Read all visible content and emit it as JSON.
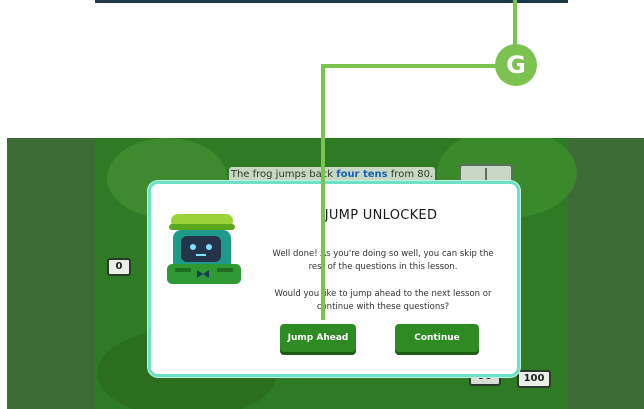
{
  "callout": {
    "label": "G"
  },
  "game": {
    "question_prefix": "The frog jumps back ",
    "question_emph": "four tens",
    "question_suffix": " from 80.",
    "numbers": {
      "start": "0",
      "near_end": "90",
      "end": "100"
    }
  },
  "modal": {
    "title": "JUMP UNLOCKED",
    "paragraph1": "Well done! As you're doing so well, you can skip the rest of the questions in this lesson.",
    "paragraph2": "Would you like to jump ahead to the next lesson or continue with these questions?",
    "jump_ahead_label": "Jump Ahead",
    "continue_label": "Continue"
  },
  "colors": {
    "accent_green": "#7bc251",
    "button_green": "#2e8a22",
    "modal_border": "#6ee0c4",
    "game_bg": "#2f7a24",
    "question_emphasis": "#1a5fb4"
  }
}
